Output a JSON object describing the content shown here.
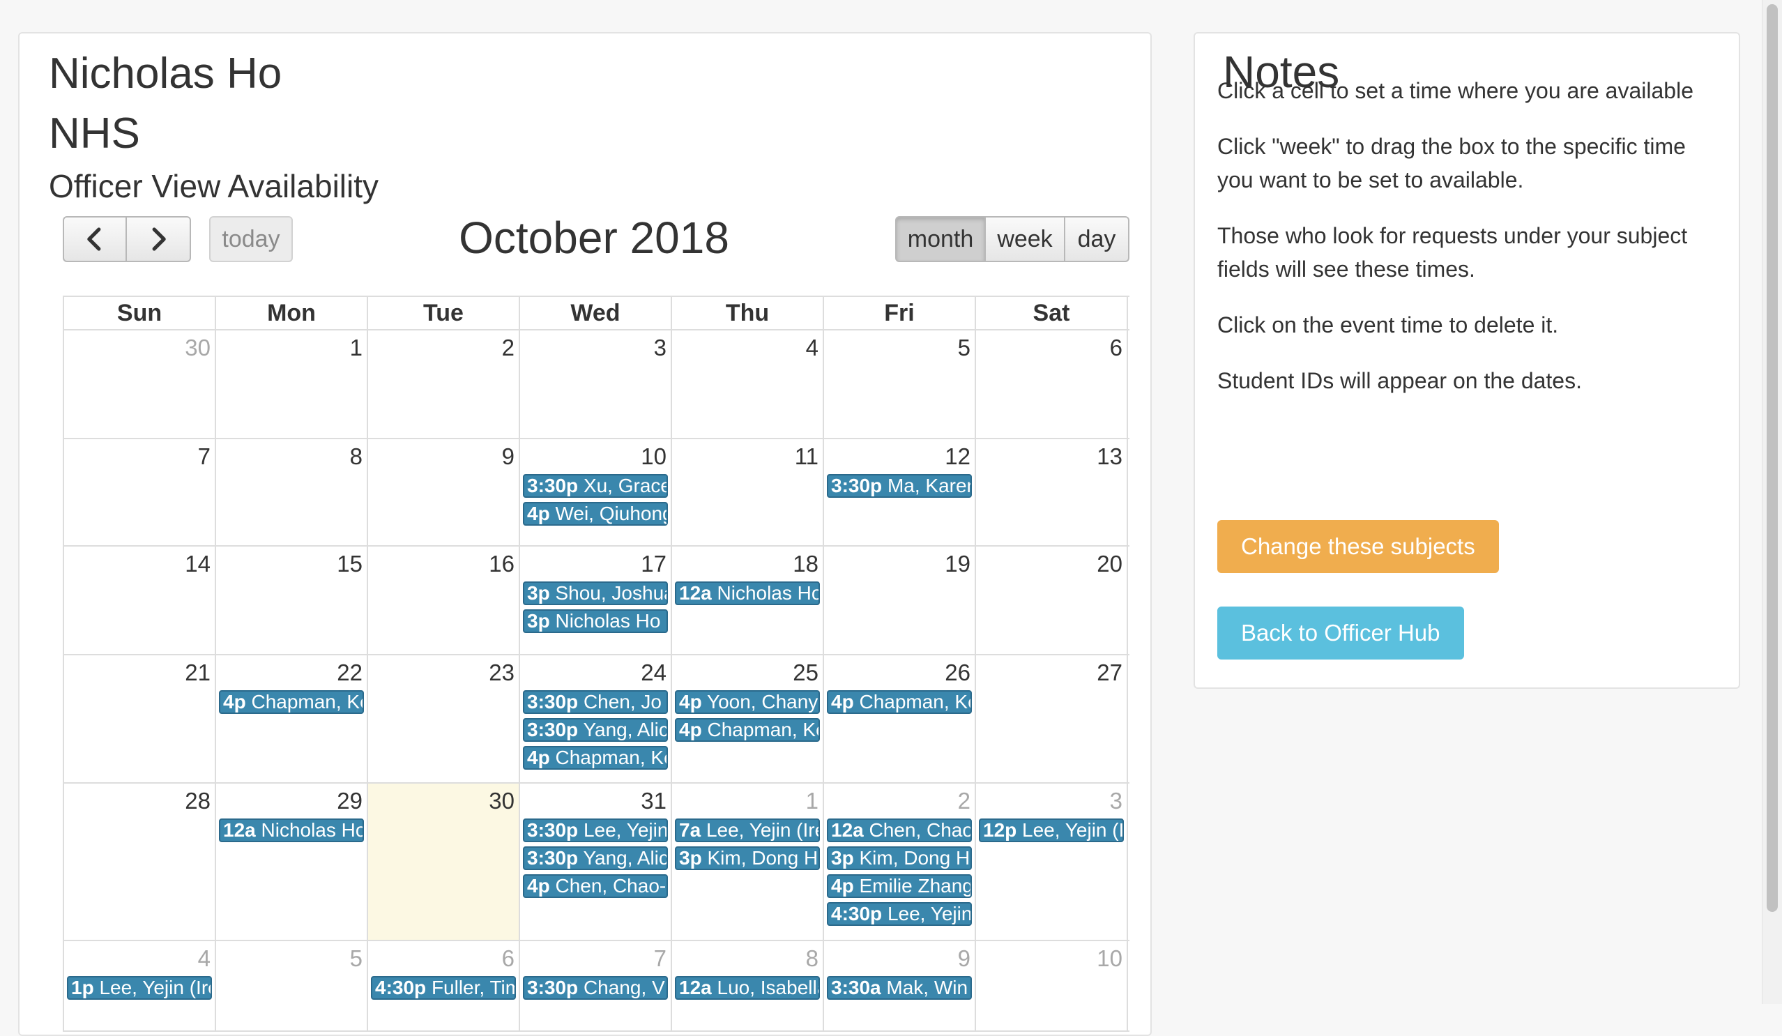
{
  "header": {
    "name": "Nicholas Ho",
    "org": "NHS",
    "page_title": "Officer View Availability"
  },
  "toolbar": {
    "today_label": "today",
    "title": "October 2018",
    "views": [
      "month",
      "week",
      "day"
    ],
    "active_view": "month"
  },
  "calendar": {
    "day_names": [
      "Sun",
      "Mon",
      "Tue",
      "Wed",
      "Thu",
      "Fri",
      "Sat"
    ],
    "weeks": [
      {
        "days": [
          {
            "num": "30",
            "other": true,
            "events": []
          },
          {
            "num": "1",
            "events": []
          },
          {
            "num": "2",
            "events": []
          },
          {
            "num": "3",
            "events": []
          },
          {
            "num": "4",
            "events": []
          },
          {
            "num": "5",
            "events": []
          },
          {
            "num": "6",
            "events": []
          }
        ]
      },
      {
        "days": [
          {
            "num": "7",
            "events": []
          },
          {
            "num": "8",
            "events": []
          },
          {
            "num": "9",
            "events": []
          },
          {
            "num": "10",
            "events": [
              {
                "time": "3:30p",
                "title": "Xu, Grace"
              },
              {
                "time": "4p",
                "title": "Wei, Qiuhong"
              }
            ]
          },
          {
            "num": "11",
            "events": []
          },
          {
            "num": "12",
            "events": [
              {
                "time": "3:30p",
                "title": "Ma, Karen"
              }
            ]
          },
          {
            "num": "13",
            "events": []
          }
        ]
      },
      {
        "days": [
          {
            "num": "14",
            "events": []
          },
          {
            "num": "15",
            "events": []
          },
          {
            "num": "16",
            "events": []
          },
          {
            "num": "17",
            "events": [
              {
                "time": "3p",
                "title": "Shou, Joshua"
              },
              {
                "time": "3p",
                "title": "Nicholas Ho"
              }
            ]
          },
          {
            "num": "18",
            "events": [
              {
                "time": "12a",
                "title": "Nicholas Ho"
              }
            ]
          },
          {
            "num": "19",
            "events": []
          },
          {
            "num": "20",
            "events": []
          }
        ]
      },
      {
        "days": [
          {
            "num": "21",
            "events": []
          },
          {
            "num": "22",
            "events": [
              {
                "time": "4p",
                "title": "Chapman, Kevin"
              }
            ]
          },
          {
            "num": "23",
            "events": []
          },
          {
            "num": "24",
            "events": [
              {
                "time": "3:30p",
                "title": "Chen, Jo"
              },
              {
                "time": "3:30p",
                "title": "Yang, Alice"
              },
              {
                "time": "4p",
                "title": "Chapman, Kevin"
              }
            ]
          },
          {
            "num": "25",
            "events": [
              {
                "time": "4p",
                "title": "Yoon, Chany"
              },
              {
                "time": "4p",
                "title": "Chapman, Kevin"
              }
            ]
          },
          {
            "num": "26",
            "events": [
              {
                "time": "4p",
                "title": "Chapman, Kevin"
              }
            ]
          },
          {
            "num": "27",
            "events": []
          }
        ]
      },
      {
        "days": [
          {
            "num": "28",
            "events": []
          },
          {
            "num": "29",
            "events": [
              {
                "time": "12a",
                "title": "Nicholas Ho"
              }
            ]
          },
          {
            "num": "30",
            "today": true,
            "events": []
          },
          {
            "num": "31",
            "events": [
              {
                "time": "3:30p",
                "title": "Lee, Yejin"
              },
              {
                "time": "3:30p",
                "title": "Yang, Alice"
              },
              {
                "time": "4p",
                "title": "Chen, Chao-"
              }
            ]
          },
          {
            "num": "1",
            "other": true,
            "events": [
              {
                "time": "7a",
                "title": "Lee, Yejin (Irene)"
              },
              {
                "time": "3p",
                "title": "Kim, Dong H"
              }
            ]
          },
          {
            "num": "2",
            "other": true,
            "events": [
              {
                "time": "12a",
                "title": "Chen, Chao"
              },
              {
                "time": "3p",
                "title": "Kim, Dong H"
              },
              {
                "time": "4p",
                "title": "Emilie Zhang"
              },
              {
                "time": "4:30p",
                "title": "Lee, Yejin"
              }
            ]
          },
          {
            "num": "3",
            "other": true,
            "events": [
              {
                "time": "12p",
                "title": "Lee, Yejin (Irene)"
              }
            ]
          }
        ]
      },
      {
        "days": [
          {
            "num": "4",
            "other": true,
            "events": [
              {
                "time": "1p",
                "title": "Lee, Yejin (Irene)"
              }
            ]
          },
          {
            "num": "5",
            "other": true,
            "events": []
          },
          {
            "num": "6",
            "other": true,
            "events": [
              {
                "time": "4:30p",
                "title": "Fuller, Tim"
              }
            ]
          },
          {
            "num": "7",
            "other": true,
            "events": [
              {
                "time": "3:30p",
                "title": "Chang, V"
              }
            ]
          },
          {
            "num": "8",
            "other": true,
            "events": [
              {
                "time": "12a",
                "title": "Luo, Isabella"
              }
            ]
          },
          {
            "num": "9",
            "other": true,
            "events": [
              {
                "time": "3:30a",
                "title": "Mak, Win"
              }
            ]
          },
          {
            "num": "10",
            "other": true,
            "events": []
          }
        ]
      }
    ]
  },
  "notes": {
    "title": "Notes",
    "items": [
      "Click a cell to set a time where you are available",
      "Click \"week\" to drag the box to the specific time you want to be set to available.",
      "Those who look for requests under your subject fields will see these times.",
      "Click on the event time to delete it.",
      "Student IDs will appear on the dates."
    ],
    "change_subjects_label": "Change these subjects",
    "back_label": "Back to Officer Hub"
  },
  "colors": {
    "event_bg": "#3a87ad",
    "today_bg": "#fcf8e3",
    "change_btn": "#f0ad4e",
    "back_btn": "#5bc0de"
  }
}
